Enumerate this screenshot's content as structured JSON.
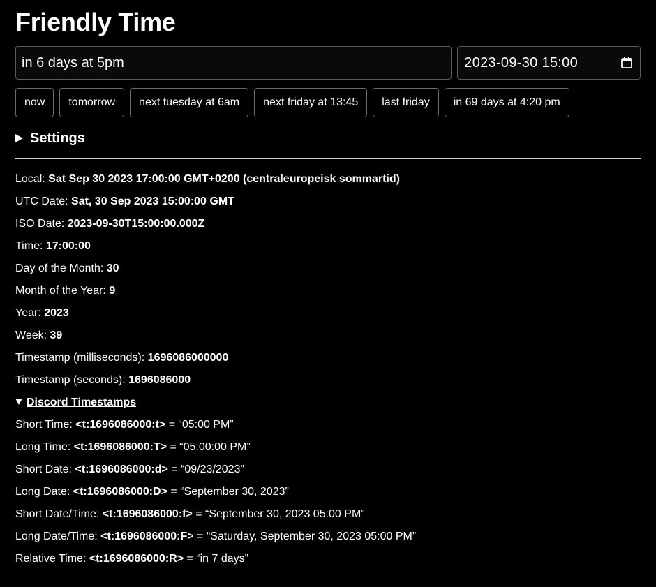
{
  "title": "Friendly Time",
  "query_input": {
    "value": "in 6 days at 5pm"
  },
  "datetime_input": {
    "value": "2023-09-30 15:00",
    "icon": "calendar-icon"
  },
  "presets": [
    "now",
    "tomorrow",
    "next tuesday at 6am",
    "next friday at 13:45",
    "last friday",
    "in 69 days at 4:20 pm"
  ],
  "settings": {
    "label": "Settings",
    "expanded": false
  },
  "info": {
    "local": {
      "label": "Local:",
      "value": "Sat Sep 30 2023 17:00:00 GMT+0200 (centraleuropeisk sommartid)"
    },
    "utc": {
      "label": "UTC Date:",
      "value": "Sat, 30 Sep 2023 15:00:00 GMT"
    },
    "iso": {
      "label": "ISO Date:",
      "value": "2023-09-30T15:00:00.000Z"
    },
    "time": {
      "label": "Time:",
      "value": "17:00:00"
    },
    "day": {
      "label": "Day of the Month:",
      "value": "30"
    },
    "month": {
      "label": "Month of the Year:",
      "value": "9"
    },
    "year": {
      "label": "Year:",
      "value": "2023"
    },
    "week": {
      "label": "Week:",
      "value": "39"
    },
    "ts_ms": {
      "label": "Timestamp (milliseconds):",
      "value": "1696086000000"
    },
    "ts_s": {
      "label": "Timestamp (seconds):",
      "value": "1696086000"
    }
  },
  "discord": {
    "label": "Discord Timestamps",
    "expanded": true,
    "items": [
      {
        "label": "Short Time:",
        "code": "<t:1696086000:t>",
        "result": "= “05:00 PM”"
      },
      {
        "label": "Long Time:",
        "code": "<t:1696086000:T>",
        "result": "= “05:00:00 PM”"
      },
      {
        "label": "Short Date:",
        "code": "<t:1696086000:d>",
        "result": "= “09/23/2023”"
      },
      {
        "label": "Long Date:",
        "code": "<t:1696086000:D>",
        "result": "= “September 30, 2023”"
      },
      {
        "label": "Short Date/Time:",
        "code": "<t:1696086000:f>",
        "result": "= “September 30, 2023 05:00 PM”"
      },
      {
        "label": "Long Date/Time:",
        "code": "<t:1696086000:F>",
        "result": "= “Saturday, September 30, 2023 05:00 PM”"
      },
      {
        "label": "Relative Time:",
        "code": "<t:1696086000:R>",
        "result": "= “in 7 days”"
      }
    ]
  }
}
